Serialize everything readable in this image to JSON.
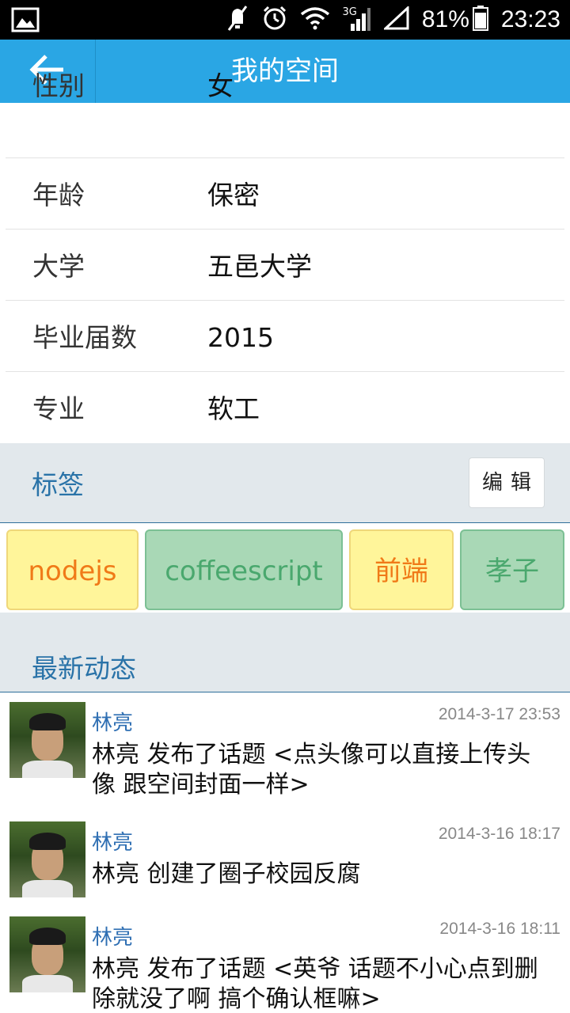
{
  "status_bar": {
    "battery": "81%",
    "time": "23:23",
    "network": "3G",
    "icons": [
      "image-icon",
      "mute-icon",
      "alarm-icon",
      "wifi-icon",
      "signal-icon",
      "battery-icon"
    ]
  },
  "header": {
    "title": "我的空间",
    "back_icon": "back-arrow-icon"
  },
  "profile": {
    "rows": [
      {
        "label": "性别",
        "value": "女"
      },
      {
        "label": "年龄",
        "value": "保密"
      },
      {
        "label": "大学",
        "value": "五邑大学"
      },
      {
        "label": "毕业届数",
        "value": "2015"
      },
      {
        "label": "专业",
        "value": "软工"
      }
    ]
  },
  "tags": {
    "title": "标签",
    "edit_label": "编辑",
    "items": [
      {
        "label": "nodejs",
        "color": "#f07a18",
        "bg": "#fff59a"
      },
      {
        "label": "coffeescript",
        "color": "#4aa86e",
        "bg": "#a9d8b6"
      },
      {
        "label": "前端",
        "color": "#f07a18",
        "bg": "#fff59a"
      },
      {
        "label": "孝子",
        "color": "#4aa86e",
        "bg": "#a9d8b6"
      }
    ]
  },
  "activity": {
    "title": "最新动态",
    "items": [
      {
        "user": "林亮",
        "time": "2014-3-17 23:53",
        "text": "林亮 发布了话题 <点头像可以直接上传头像 跟空间封面一样>"
      },
      {
        "user": "林亮",
        "time": "2014-3-16 18:17",
        "text": "林亮 创建了圈子校园反腐"
      },
      {
        "user": "林亮",
        "time": "2014-3-16 18:11",
        "text": "林亮 发布了话题 <英爷 话题不小心点到删除就没了啊 搞个确认框嘛>"
      }
    ]
  },
  "colors": {
    "accent": "#2aa6e4",
    "section_bg": "#e2e8ec",
    "section_title": "#2a73a8",
    "link": "#2f6fb3"
  }
}
